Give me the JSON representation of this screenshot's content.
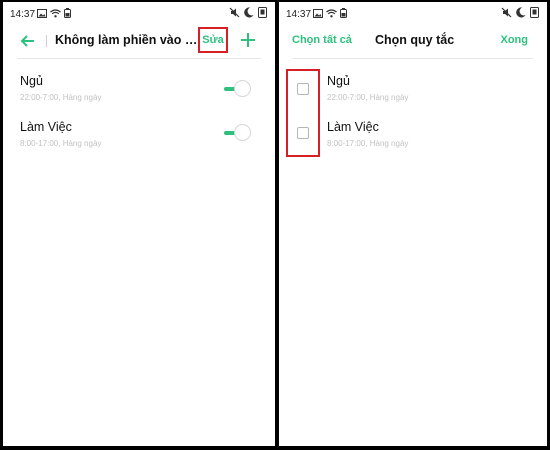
{
  "status_bar": {
    "time": "14:37"
  },
  "left_screen": {
    "title": "Không làm phiền vào cá...",
    "edit_label": "Sửa",
    "rules": [
      {
        "name": "Ngủ",
        "schedule": "22:00-7:00, Hàng ngày",
        "enabled": true
      },
      {
        "name": "Làm Việc",
        "schedule": "8:00-17:00, Hàng ngày",
        "enabled": true
      }
    ]
  },
  "right_screen": {
    "select_all_label": "Chọn tất cả",
    "title": "Chọn quy tắc",
    "done_label": "Xong",
    "rules": [
      {
        "name": "Ngủ",
        "schedule": "22:00-7:00, Hàng ngày",
        "checked": false
      },
      {
        "name": "Làm Việc",
        "schedule": "8:00-17:00, Hàng ngày",
        "checked": false
      }
    ]
  },
  "colors": {
    "accent": "#2dc07f",
    "highlight": "#d71f26",
    "background": "#000000"
  },
  "icons": [
    "arrow-left-icon",
    "plus-icon",
    "image-icon",
    "wifi-icon",
    "battery-icon",
    "mute-icon",
    "moon-icon",
    "app-icon"
  ]
}
